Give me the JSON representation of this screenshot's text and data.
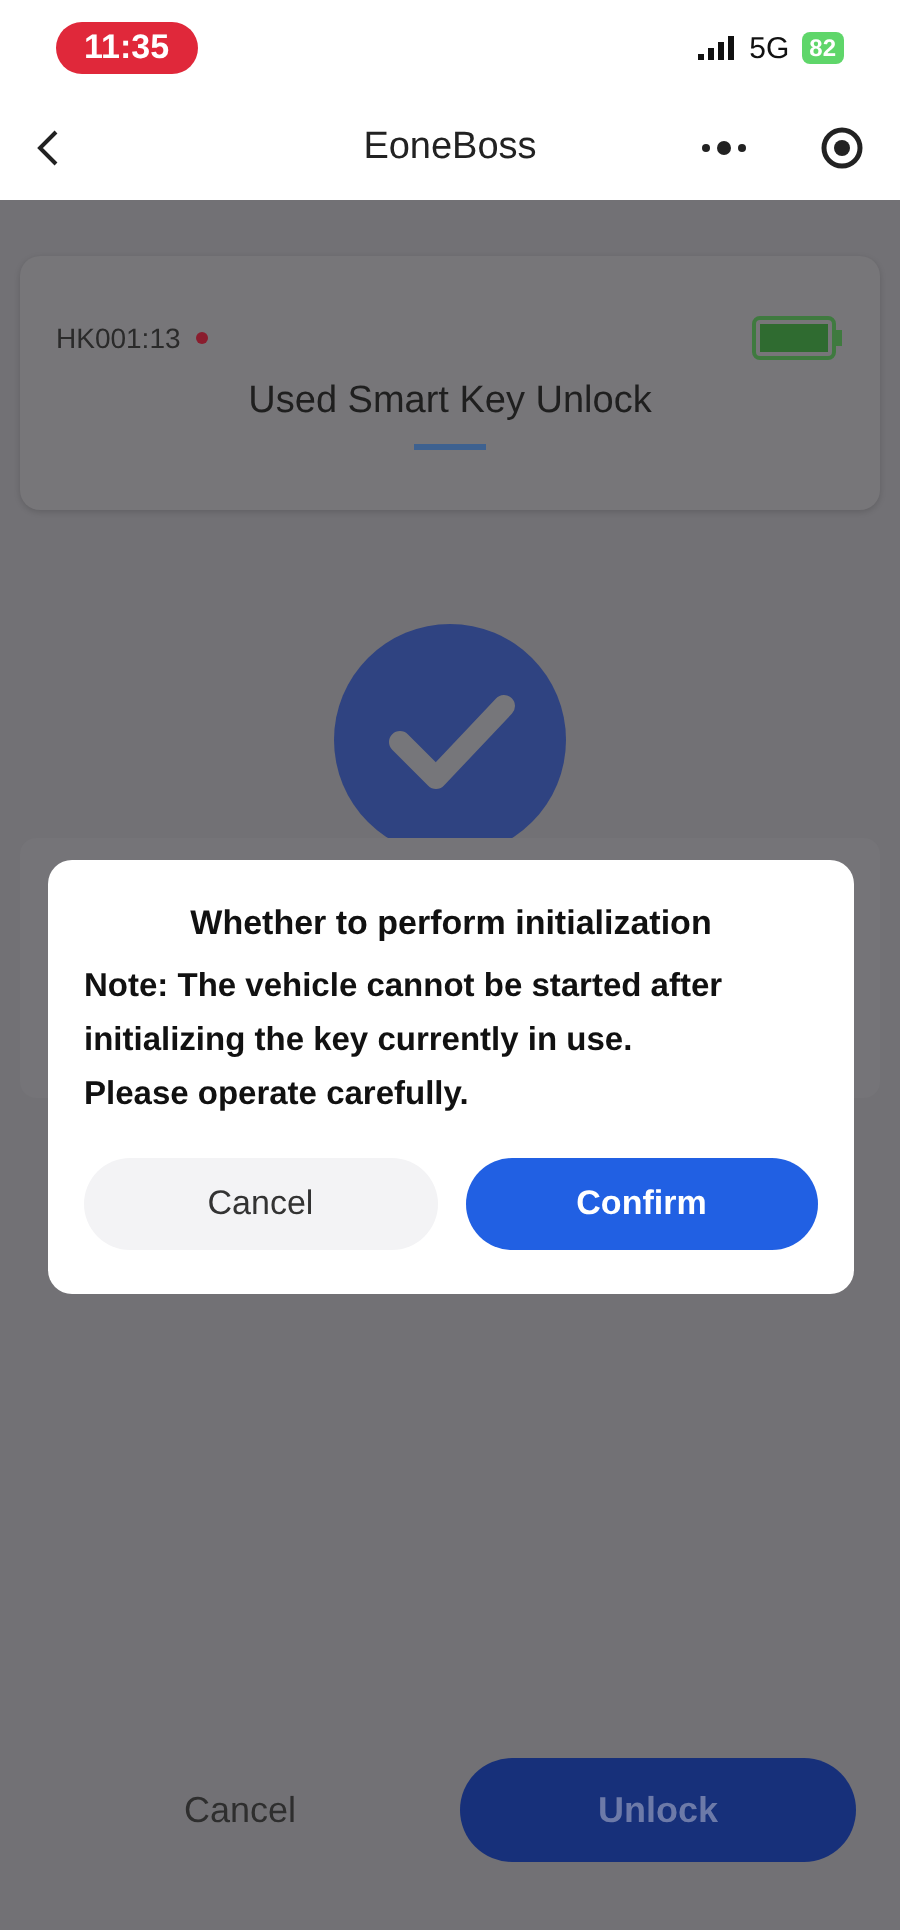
{
  "status_bar": {
    "time": "11:35",
    "network": "5G",
    "battery": "82"
  },
  "nav_bar": {
    "title": "EoneBoss"
  },
  "device_card": {
    "device": "HK001:13",
    "title": "Used Smart Key Unlock"
  },
  "dialog": {
    "title": "Whether to perform initialization",
    "message": "Note: The vehicle cannot be started after initializing the key currently in use. Please operate carefully.",
    "buttons": [
      {
        "label": "Cancel",
        "kind": "secondary"
      },
      {
        "label": "Confirm",
        "kind": "primary"
      }
    ]
  },
  "bottom_buttons": [
    {
      "label": "Cancel",
      "kind": "secondary"
    },
    {
      "label": "Unlock",
      "kind": "primary"
    }
  ]
}
